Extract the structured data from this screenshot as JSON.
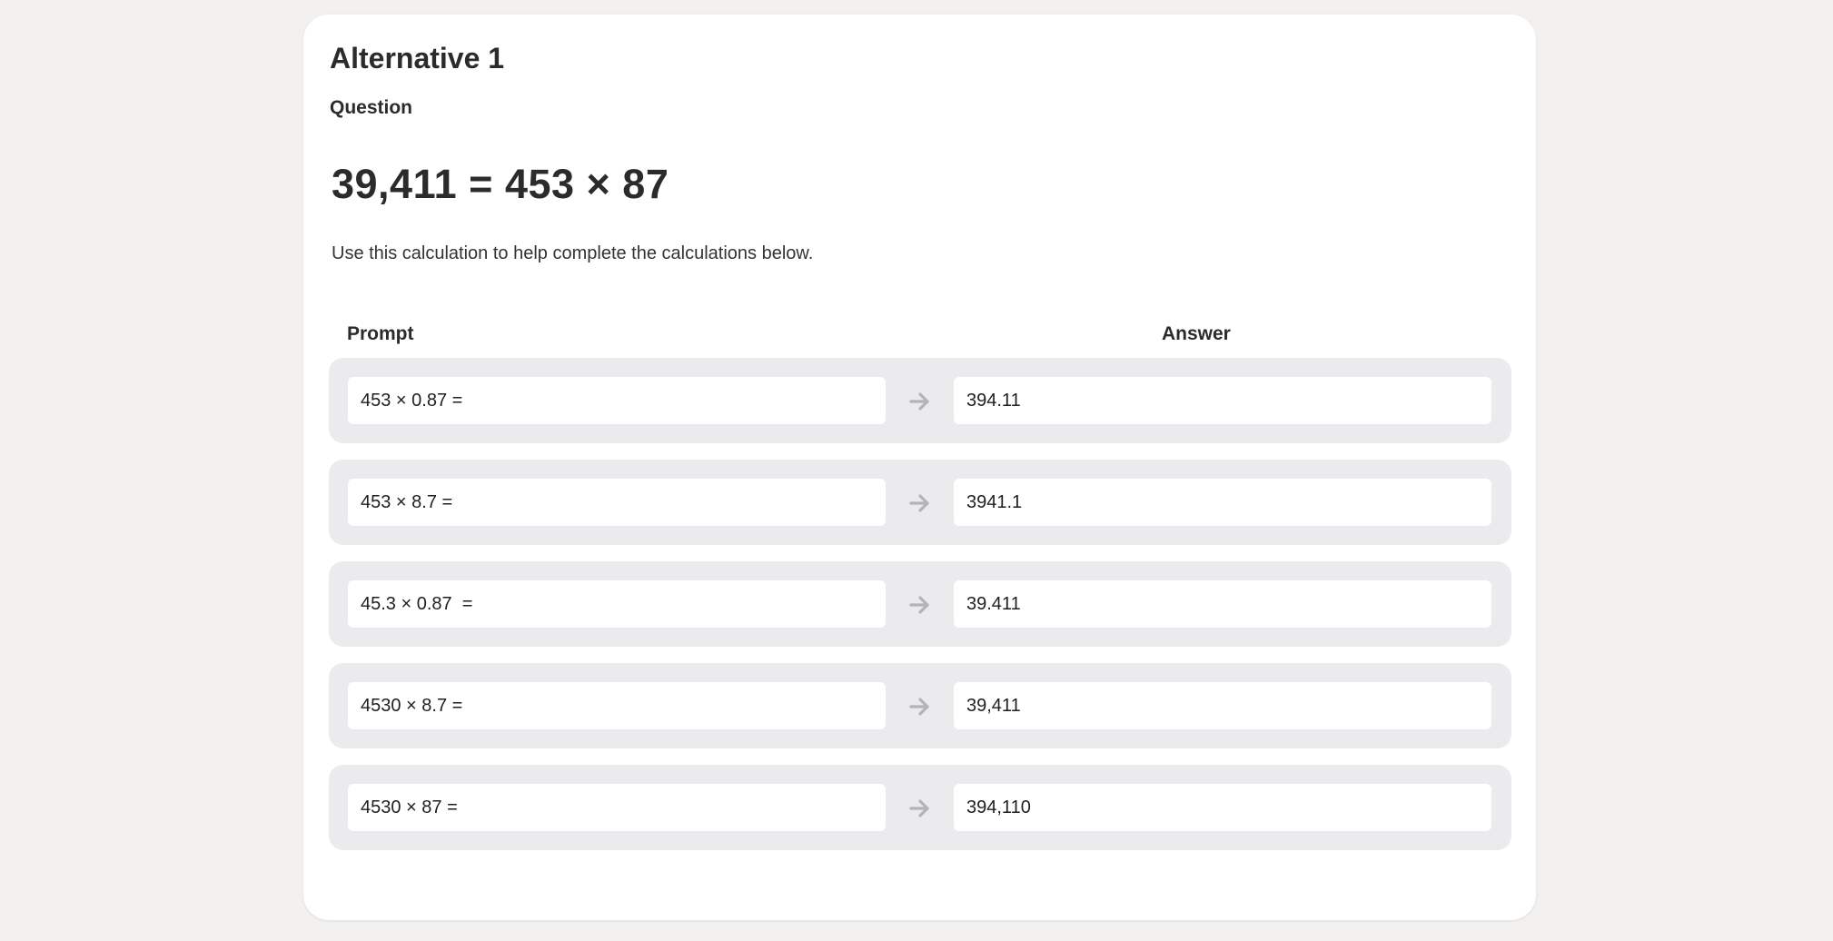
{
  "header": {
    "title": "Alternative 1",
    "subtitle": "Question"
  },
  "question": {
    "equation": "39,411 = 453 × 87",
    "instruction": "Use this calculation to help complete the calculations below."
  },
  "table": {
    "prompt_header": "Prompt",
    "answer_header": "Answer",
    "rows": [
      {
        "prompt": "453 × 0.87 =",
        "answer": "394.11"
      },
      {
        "prompt": "453 × 8.7 =",
        "answer": "3941.1"
      },
      {
        "prompt": "45.3 × 0.87  =",
        "answer": "39.411"
      },
      {
        "prompt": "4530 × 8.7 =",
        "answer": "39,411"
      },
      {
        "prompt": "4530 × 87 =",
        "answer": "394,110"
      }
    ]
  },
  "icons": {
    "arrow": "arrow-right-icon"
  },
  "colors": {
    "background": "#f2f1ef",
    "card": "#ffffff",
    "row": "#ebebed",
    "arrow": "#b4b4b8"
  }
}
